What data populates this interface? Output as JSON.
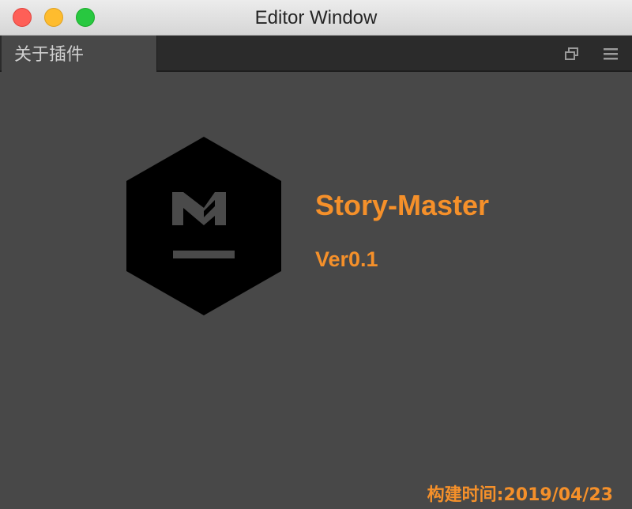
{
  "window": {
    "title": "Editor Window"
  },
  "tab": {
    "label": "关于插件"
  },
  "tab_actions": {
    "restore_icon": "restore-window-icon",
    "menu_icon": "hamburger-menu-icon"
  },
  "about": {
    "logo_icon": "story-master-logo-icon",
    "name": "Story-Master",
    "version": "Ver0.1",
    "build_time": "构建时间:2019/04/23"
  },
  "colors": {
    "accent": "#f5902a",
    "background": "#484848",
    "tab_strip": "#2b2b2b",
    "logo": "#000000",
    "logo_mark": "#4a4a4a"
  }
}
